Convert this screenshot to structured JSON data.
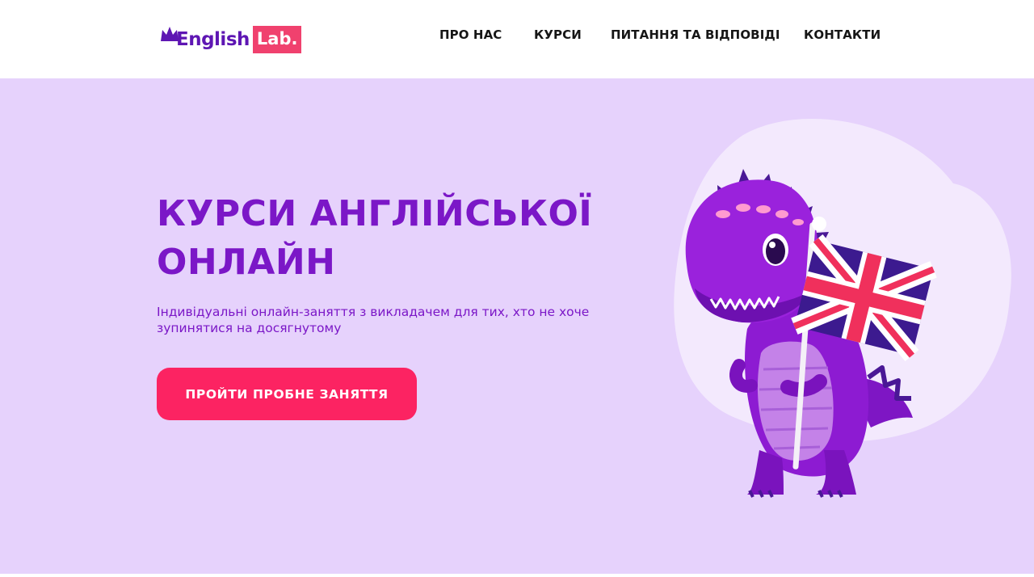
{
  "brand": {
    "name_part1": "English",
    "name_part2": "Lab.",
    "primary_color": "#7b17c7",
    "accent_color": "#fc2362",
    "hero_background": "#e6d2fc"
  },
  "nav": {
    "items": [
      {
        "label": "ПРО НАС"
      },
      {
        "label": "КУРСИ"
      },
      {
        "label": "ПИТАННЯ ТА ВІДПОВІДІ"
      },
      {
        "label": "КОНТАКТИ"
      }
    ]
  },
  "hero": {
    "title_line1": "КУРСИ АНГЛІЙСЬКОЇ",
    "title_line2": "ОНЛАЙН",
    "subtitle": "Індивідуальні онлайн-заняття з викладачем для тих, хто не хоче зупинятися на досягнутому",
    "cta_label": "ПРОЙТИ ПРОБНЕ ЗАНЯТТЯ",
    "illustration": "purple-dinosaur-with-uk-flag"
  }
}
